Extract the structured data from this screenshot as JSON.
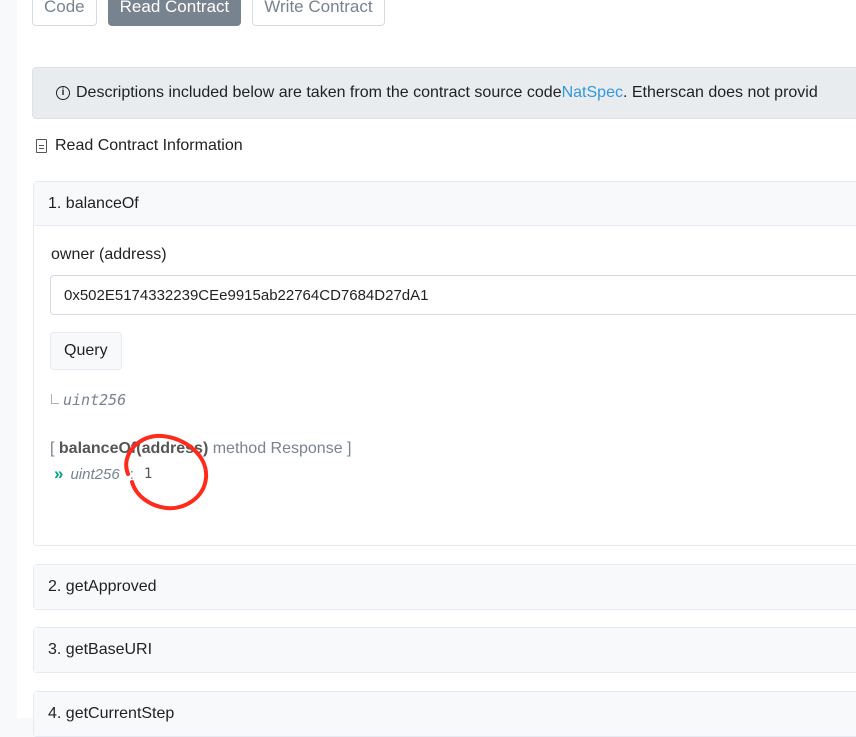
{
  "tabs": [
    {
      "label": "Code",
      "active": false
    },
    {
      "label": "Read Contract",
      "active": true
    },
    {
      "label": "Write Contract",
      "active": false
    }
  ],
  "notice": {
    "text_before": "Descriptions included below are taken from the contract source code ",
    "link": "NatSpec",
    "text_after": ". Etherscan does not provid"
  },
  "section_title": "Read Contract Information",
  "method1": {
    "header": "1. balanceOf",
    "param_label": "owner (address)",
    "param_value": "0x502E5174332239CEe9915ab22764CD7684D27dA1",
    "query_label": "Query",
    "return_type": "uint256",
    "response_open": "[ ",
    "response_method": "balanceOf(address)",
    "response_rest": " method Response ]",
    "result_type": "uint256",
    "result_sep": ":",
    "result_value": "1"
  },
  "methods": [
    {
      "header": "2. getApproved"
    },
    {
      "header": "3. getBaseURI"
    },
    {
      "header": "4. getCurrentStep"
    }
  ],
  "colors": {
    "link": "#3498db",
    "tab_active_bg": "#77838f",
    "annotation": "#ff2a1a",
    "result_arrow": "#00a186"
  }
}
